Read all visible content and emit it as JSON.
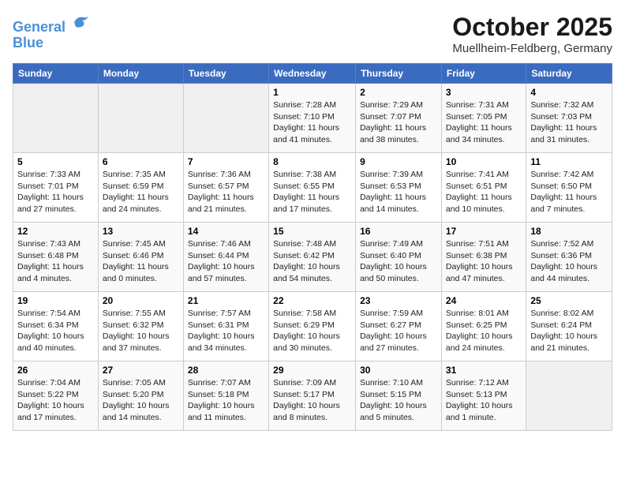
{
  "header": {
    "logo_line1": "General",
    "logo_line2": "Blue",
    "month_title": "October 2025",
    "location": "Muellheim-Feldberg, Germany"
  },
  "calendar": {
    "days_of_week": [
      "Sunday",
      "Monday",
      "Tuesday",
      "Wednesday",
      "Thursday",
      "Friday",
      "Saturday"
    ],
    "weeks": [
      [
        {
          "day": "",
          "info": ""
        },
        {
          "day": "",
          "info": ""
        },
        {
          "day": "",
          "info": ""
        },
        {
          "day": "1",
          "info": "Sunrise: 7:28 AM\nSunset: 7:10 PM\nDaylight: 11 hours and 41 minutes."
        },
        {
          "day": "2",
          "info": "Sunrise: 7:29 AM\nSunset: 7:07 PM\nDaylight: 11 hours and 38 minutes."
        },
        {
          "day": "3",
          "info": "Sunrise: 7:31 AM\nSunset: 7:05 PM\nDaylight: 11 hours and 34 minutes."
        },
        {
          "day": "4",
          "info": "Sunrise: 7:32 AM\nSunset: 7:03 PM\nDaylight: 11 hours and 31 minutes."
        }
      ],
      [
        {
          "day": "5",
          "info": "Sunrise: 7:33 AM\nSunset: 7:01 PM\nDaylight: 11 hours and 27 minutes."
        },
        {
          "day": "6",
          "info": "Sunrise: 7:35 AM\nSunset: 6:59 PM\nDaylight: 11 hours and 24 minutes."
        },
        {
          "day": "7",
          "info": "Sunrise: 7:36 AM\nSunset: 6:57 PM\nDaylight: 11 hours and 21 minutes."
        },
        {
          "day": "8",
          "info": "Sunrise: 7:38 AM\nSunset: 6:55 PM\nDaylight: 11 hours and 17 minutes."
        },
        {
          "day": "9",
          "info": "Sunrise: 7:39 AM\nSunset: 6:53 PM\nDaylight: 11 hours and 14 minutes."
        },
        {
          "day": "10",
          "info": "Sunrise: 7:41 AM\nSunset: 6:51 PM\nDaylight: 11 hours and 10 minutes."
        },
        {
          "day": "11",
          "info": "Sunrise: 7:42 AM\nSunset: 6:50 PM\nDaylight: 11 hours and 7 minutes."
        }
      ],
      [
        {
          "day": "12",
          "info": "Sunrise: 7:43 AM\nSunset: 6:48 PM\nDaylight: 11 hours and 4 minutes."
        },
        {
          "day": "13",
          "info": "Sunrise: 7:45 AM\nSunset: 6:46 PM\nDaylight: 11 hours and 0 minutes."
        },
        {
          "day": "14",
          "info": "Sunrise: 7:46 AM\nSunset: 6:44 PM\nDaylight: 10 hours and 57 minutes."
        },
        {
          "day": "15",
          "info": "Sunrise: 7:48 AM\nSunset: 6:42 PM\nDaylight: 10 hours and 54 minutes."
        },
        {
          "day": "16",
          "info": "Sunrise: 7:49 AM\nSunset: 6:40 PM\nDaylight: 10 hours and 50 minutes."
        },
        {
          "day": "17",
          "info": "Sunrise: 7:51 AM\nSunset: 6:38 PM\nDaylight: 10 hours and 47 minutes."
        },
        {
          "day": "18",
          "info": "Sunrise: 7:52 AM\nSunset: 6:36 PM\nDaylight: 10 hours and 44 minutes."
        }
      ],
      [
        {
          "day": "19",
          "info": "Sunrise: 7:54 AM\nSunset: 6:34 PM\nDaylight: 10 hours and 40 minutes."
        },
        {
          "day": "20",
          "info": "Sunrise: 7:55 AM\nSunset: 6:32 PM\nDaylight: 10 hours and 37 minutes."
        },
        {
          "day": "21",
          "info": "Sunrise: 7:57 AM\nSunset: 6:31 PM\nDaylight: 10 hours and 34 minutes."
        },
        {
          "day": "22",
          "info": "Sunrise: 7:58 AM\nSunset: 6:29 PM\nDaylight: 10 hours and 30 minutes."
        },
        {
          "day": "23",
          "info": "Sunrise: 7:59 AM\nSunset: 6:27 PM\nDaylight: 10 hours and 27 minutes."
        },
        {
          "day": "24",
          "info": "Sunrise: 8:01 AM\nSunset: 6:25 PM\nDaylight: 10 hours and 24 minutes."
        },
        {
          "day": "25",
          "info": "Sunrise: 8:02 AM\nSunset: 6:24 PM\nDaylight: 10 hours and 21 minutes."
        }
      ],
      [
        {
          "day": "26",
          "info": "Sunrise: 7:04 AM\nSunset: 5:22 PM\nDaylight: 10 hours and 17 minutes."
        },
        {
          "day": "27",
          "info": "Sunrise: 7:05 AM\nSunset: 5:20 PM\nDaylight: 10 hours and 14 minutes."
        },
        {
          "day": "28",
          "info": "Sunrise: 7:07 AM\nSunset: 5:18 PM\nDaylight: 10 hours and 11 minutes."
        },
        {
          "day": "29",
          "info": "Sunrise: 7:09 AM\nSunset: 5:17 PM\nDaylight: 10 hours and 8 minutes."
        },
        {
          "day": "30",
          "info": "Sunrise: 7:10 AM\nSunset: 5:15 PM\nDaylight: 10 hours and 5 minutes."
        },
        {
          "day": "31",
          "info": "Sunrise: 7:12 AM\nSunset: 5:13 PM\nDaylight: 10 hours and 1 minute."
        },
        {
          "day": "",
          "info": ""
        }
      ]
    ]
  }
}
